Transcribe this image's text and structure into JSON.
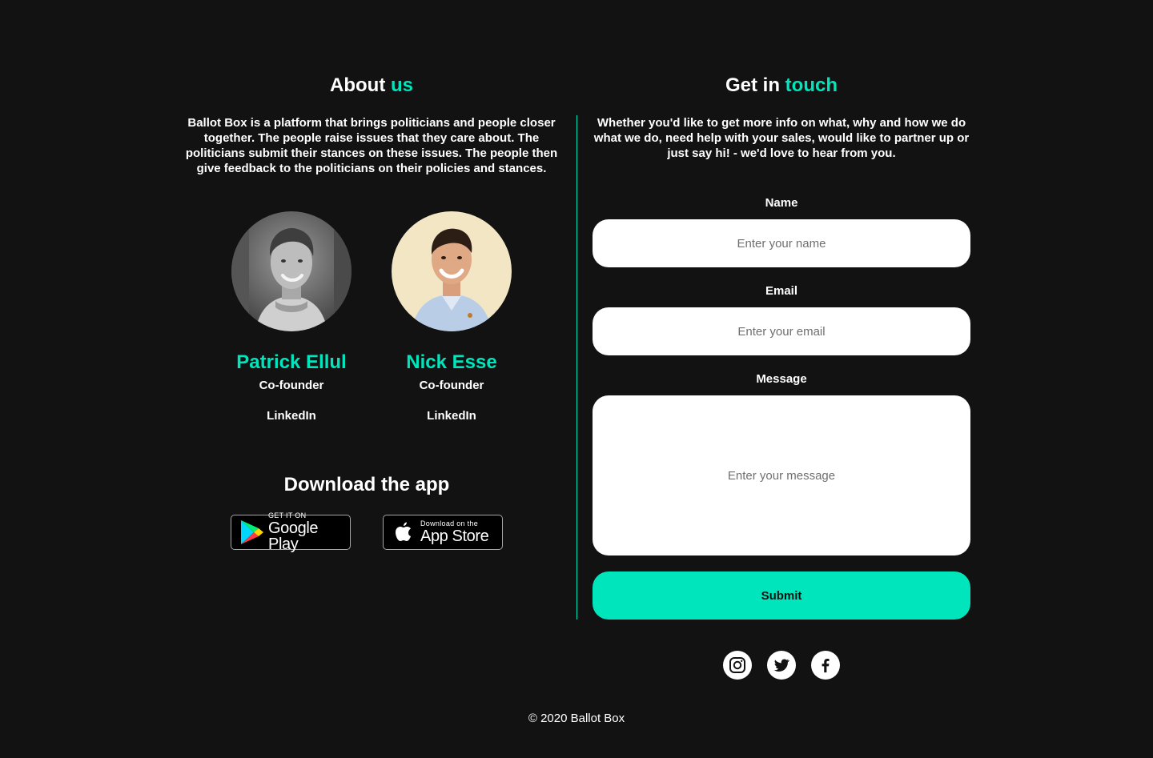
{
  "about": {
    "title_prefix": "About",
    "title_accent": "us",
    "description": "Ballot Box is a platform that brings politicians and people closer together. The people raise issues that they care about. The politicians submit their stances on these issues. The people then give feedback to the politicians on their policies and stances.",
    "founders": [
      {
        "name": "Patrick Ellul",
        "role": "Co-founder",
        "link_label": "LinkedIn"
      },
      {
        "name": "Nick Esse",
        "role": "Co-founder",
        "link_label": "LinkedIn"
      }
    ]
  },
  "download": {
    "title": "Download the app",
    "google_play": {
      "small": "GET IT ON",
      "big": "Google Play"
    },
    "app_store": {
      "small": "Download on the",
      "big": "App Store"
    }
  },
  "contact": {
    "title_prefix": "Get in",
    "title_accent": "touch",
    "description": "Whether you'd like to get more info on what, why and how we do what we do, need help with your sales, would like to partner up or just say hi! - we'd love to hear from you.",
    "name_label": "Name",
    "name_placeholder": "Enter your name",
    "email_label": "Email",
    "email_placeholder": "Enter your email",
    "message_label": "Message",
    "message_placeholder": "Enter your message",
    "submit_label": "Submit"
  },
  "social": [
    "instagram-icon",
    "twitter-icon",
    "facebook-icon"
  ],
  "footer": {
    "copyright": "© 2020 Ballot Box"
  },
  "colors": {
    "accent": "#00e5bc",
    "background": "#121212",
    "text": "#ffffff"
  }
}
